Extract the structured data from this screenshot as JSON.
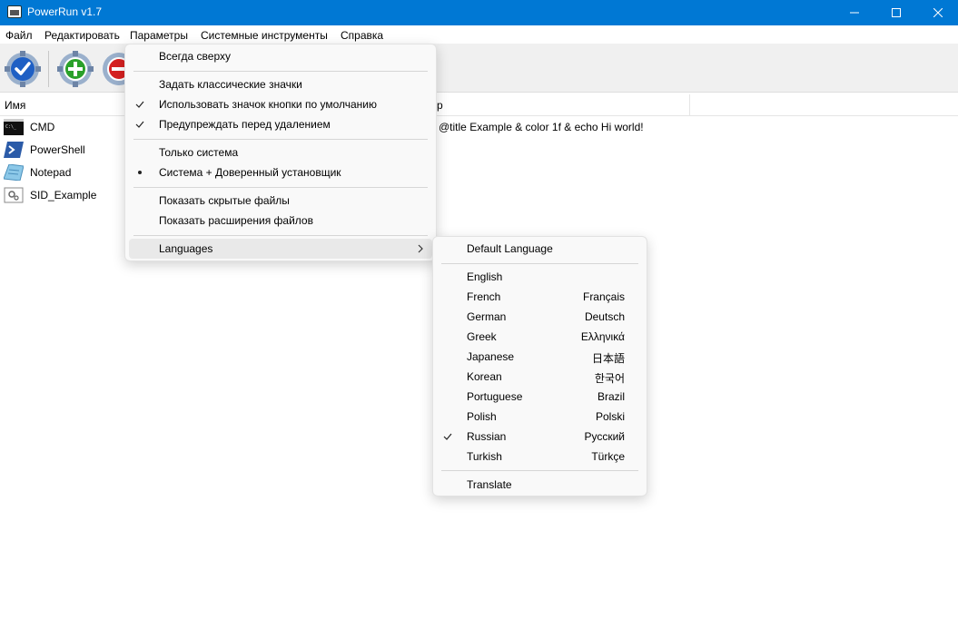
{
  "window": {
    "title": "PowerRun v1.7"
  },
  "menubar": [
    "Файл",
    "Редактировать",
    "Параметры",
    "Системные инструменты",
    "Справка"
  ],
  "toolbar": {
    "buttons": [
      {
        "icon": "run-check-icon",
        "color": "#1e5fc4"
      },
      {
        "icon": "add-icon",
        "color": "#2aa02a"
      },
      {
        "icon": "remove-icon",
        "color": "#d62020"
      }
    ]
  },
  "list": {
    "columns": {
      "name": "Имя",
      "param": "р"
    },
    "rows": [
      {
        "name": "CMD",
        "param": "@title Example & color 1f & echo Hi world!",
        "icon": "cmd-icon"
      },
      {
        "name": "PowerShell",
        "param": "",
        "icon": "powershell-icon"
      },
      {
        "name": "Notepad",
        "param": "",
        "icon": "notepad-icon"
      },
      {
        "name": "SID_Example",
        "param": "",
        "icon": "sid-icon"
      }
    ]
  },
  "params_menu": {
    "always_on_top": "Всегда сверху",
    "classic_icons": "Задать классические значки",
    "default_button_icon": "Использовать значок кнопки по умолчанию",
    "warn_before_delete": "Предупреждать перед удалением",
    "system_only": "Только система",
    "system_trusted": "Система + Доверенный установщик",
    "show_hidden": "Показать скрытые файлы",
    "show_extensions": "Показать расширения файлов",
    "languages": "Languages"
  },
  "languages_menu": {
    "default": "Default Language",
    "items": [
      {
        "english": "English",
        "native": ""
      },
      {
        "english": "French",
        "native": "Français"
      },
      {
        "english": "German",
        "native": "Deutsch"
      },
      {
        "english": "Greek",
        "native": "Ελληνικά"
      },
      {
        "english": "Japanese",
        "native": "日本語"
      },
      {
        "english": "Korean",
        "native": "한국어"
      },
      {
        "english": "Portuguese",
        "native": "Brazil"
      },
      {
        "english": "Polish",
        "native": "Polski"
      },
      {
        "english": "Russian",
        "native": "Русский",
        "checked": true
      },
      {
        "english": "Turkish",
        "native": "Türkçe"
      }
    ],
    "translate": "Translate"
  }
}
